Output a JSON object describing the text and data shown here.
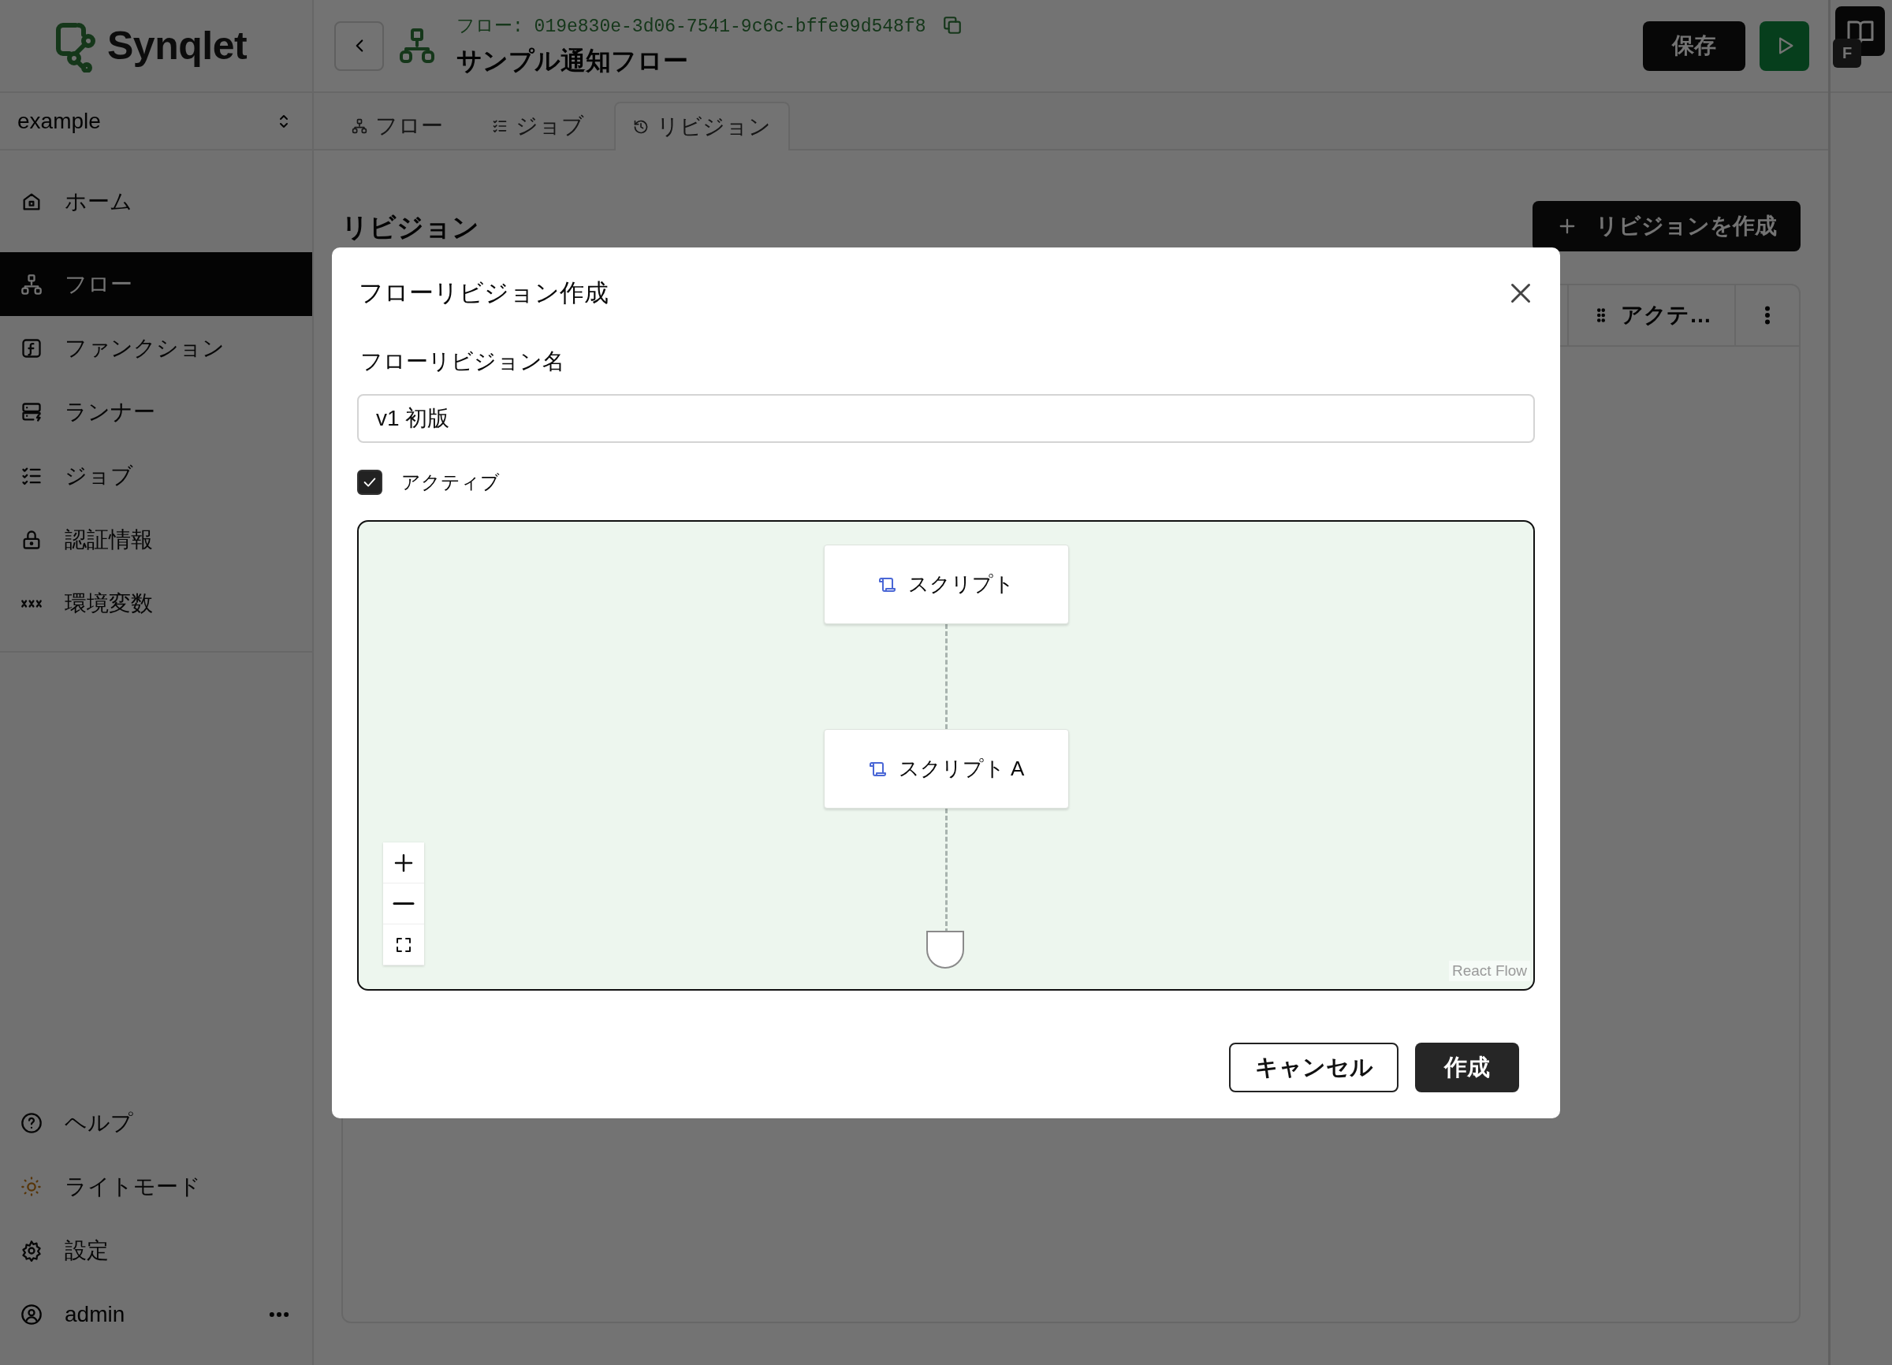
{
  "sidebar": {
    "logo": "Synqlet",
    "workspace": "example",
    "nav": [
      {
        "label": "ホーム",
        "selected": false
      },
      {
        "label": "フロー",
        "selected": true
      },
      {
        "label": "ファンクション",
        "selected": false
      },
      {
        "label": "ランナー",
        "selected": false
      },
      {
        "label": "ジョブ",
        "selected": false
      },
      {
        "label": "認証情報",
        "selected": false
      },
      {
        "label": "環境変数",
        "selected": false
      }
    ],
    "bottom_nav": [
      {
        "label": "ヘルプ"
      },
      {
        "label": "ライトモード"
      },
      {
        "label": "設定"
      }
    ],
    "user": {
      "name": "admin"
    }
  },
  "header": {
    "flow_id": "フロー: 019e830e-3d06-7541-9c6c-bffe99d548f8",
    "title": "サンプル通知フロー",
    "save_button": "保存"
  },
  "tabs": [
    {
      "label": "フロー",
      "selected": false
    },
    {
      "label": "ジョブ",
      "selected": false
    },
    {
      "label": "リビジョン",
      "selected": true
    }
  ],
  "page": {
    "title": "リビジョン",
    "create_button": "リビジョンを作成",
    "table": {
      "columns": [
        "アクテ…"
      ]
    }
  },
  "rail": {
    "badge": "F"
  },
  "dialog": {
    "title": "フローリビジョン作成",
    "name_label": "フローリビジョン名",
    "name_value": "v1 初版",
    "active": {
      "label": "アクティブ",
      "checked": true
    },
    "flow": {
      "nodes": [
        {
          "label": "スクリプト"
        },
        {
          "label": "スクリプト A"
        }
      ],
      "attribution": "React Flow"
    },
    "buttons": [
      {
        "label": "キャンセル",
        "kind": "secondary"
      },
      {
        "label": "作成",
        "kind": "primary"
      }
    ]
  }
}
